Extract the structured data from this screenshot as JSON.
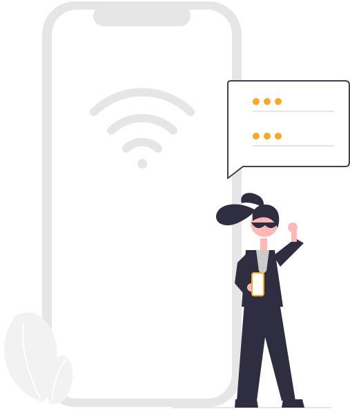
{
  "illustration": {
    "subject": "",
    "phone": {
      "frame_color": "#e6e6e6",
      "screen_color": "#ffffff",
      "wifi_icon_color": "#e6e6e6"
    },
    "chat_bubble": {
      "border_color": "#3f3d56",
      "dot_color": "#f9a826",
      "line_color": "#e6e6e6",
      "rows": 2,
      "dots_per_row": 3
    },
    "person": {
      "suit_color": "#2f2e41",
      "skin_color": "#ffb8b8",
      "shirt_color": "#cccccc",
      "phone_color": "#f9a826"
    },
    "plant": {
      "leaf_color": "#f2f2f2",
      "vein_color": "#ffffff"
    },
    "ground_line_color": "#e6e6e6"
  }
}
